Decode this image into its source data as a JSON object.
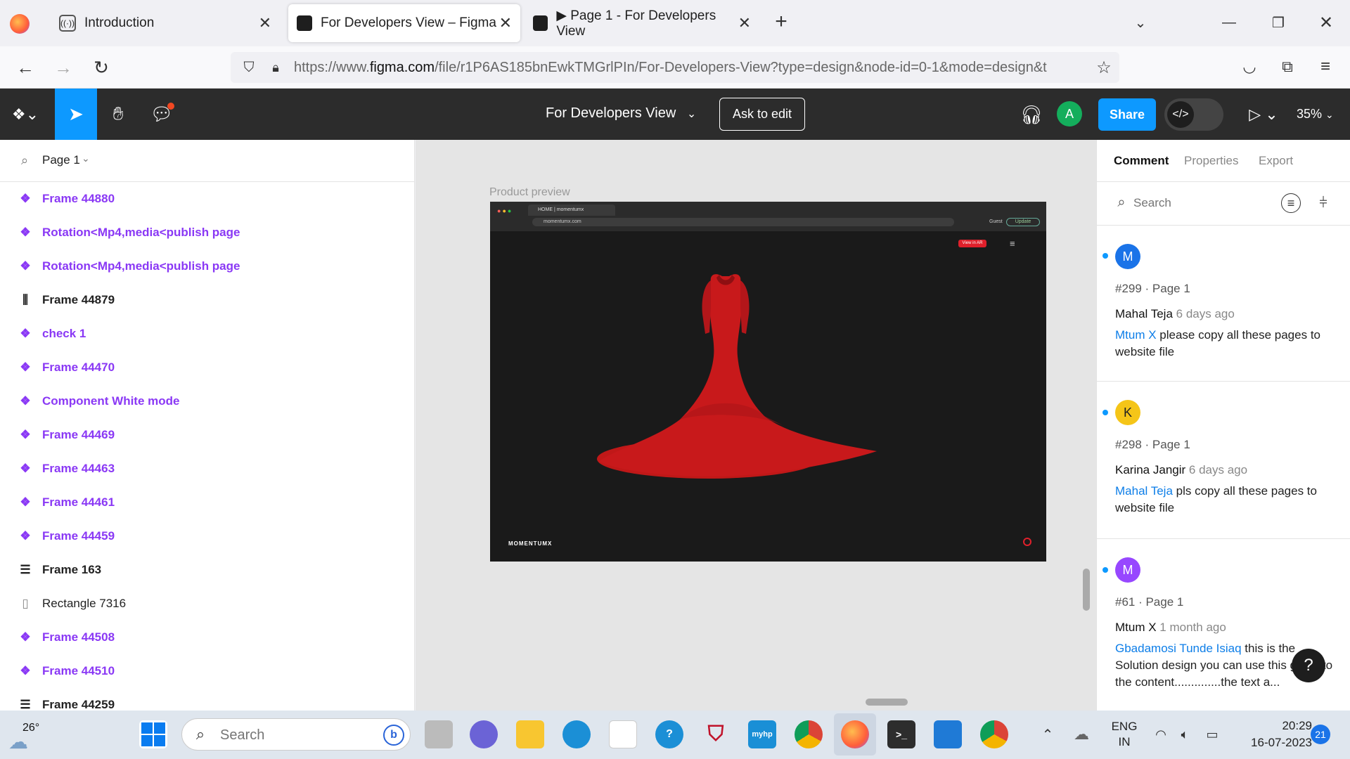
{
  "browser": {
    "tabs": [
      {
        "label": "Introduction"
      },
      {
        "label": "For Developers View – Figma"
      },
      {
        "label": "▶ Page 1 - For Developers View"
      }
    ],
    "url_prefix": "https://www.",
    "url_domain": "figma.com",
    "url_rest": "/file/r1P6AS185bnEwkTMGrlPIn/For-Developers-View?type=design&node-id=0-1&mode=design&t"
  },
  "figma": {
    "file_title": "For Developers View",
    "ask_to_edit": "Ask to edit",
    "avatar_initial": "A",
    "share_label": "Share",
    "zoom": "35%",
    "page_selector": "Page 1",
    "layers": [
      {
        "name": "Frame 44880",
        "icon": "component-icon",
        "style": "purple"
      },
      {
        "name": "Rotation<Mp4,media<publish page",
        "icon": "component-icon",
        "style": "purple"
      },
      {
        "name": "Rotation<Mp4,media<publish page",
        "icon": "component-icon",
        "style": "purple"
      },
      {
        "name": "Frame 44879",
        "icon": "auto-layout-horizontal-icon",
        "style": "dark"
      },
      {
        "name": "check 1",
        "icon": "component-icon",
        "style": "purple"
      },
      {
        "name": "Frame 44470",
        "icon": "component-icon",
        "style": "purple"
      },
      {
        "name": "Component White mode",
        "icon": "component-icon",
        "style": "purple"
      },
      {
        "name": "Frame 44469",
        "icon": "component-icon",
        "style": "purple"
      },
      {
        "name": "Frame 44463",
        "icon": "component-icon",
        "style": "purple"
      },
      {
        "name": "Frame 44461",
        "icon": "component-icon",
        "style": "purple"
      },
      {
        "name": "Frame 44459",
        "icon": "component-icon",
        "style": "purple"
      },
      {
        "name": "Frame 163",
        "icon": "auto-layout-vertical-icon",
        "style": "dark"
      },
      {
        "name": "Rectangle 7316",
        "icon": "rectangle-icon",
        "style": "plain"
      },
      {
        "name": "Frame 44508",
        "icon": "component-icon",
        "style": "purple"
      },
      {
        "name": "Frame 44510",
        "icon": "component-icon",
        "style": "purple"
      },
      {
        "name": "Frame 44259",
        "icon": "auto-layout-vertical-icon",
        "style": "dark"
      }
    ],
    "canvas": {
      "frame_label": "Product preview",
      "preview_tab": "HOME | momentumx",
      "preview_url": "momentumx.com",
      "preview_guest": "Guest",
      "preview_update": "Update",
      "preview_view_ar": "View in AR",
      "preview_logo": "MOMENTUMX"
    },
    "right_tabs": [
      "Comment",
      "Properties",
      "Export"
    ],
    "search_placeholder": "Search",
    "comments": [
      {
        "initial": "M",
        "color": "#1a73e8",
        "meta": "#299 · Page 1",
        "author": "Mahal Teja",
        "time": "6 days ago",
        "mention": "Mtum X",
        "text": " please copy all these pages to website file"
      },
      {
        "initial": "K",
        "color": "#f5c518",
        "meta": "#298 · Page 1",
        "author": "Karina Jangir",
        "time": "6 days ago",
        "mention": "Mahal Teja",
        "text": " pls copy all these pages to website file"
      },
      {
        "initial": "M",
        "color": "#9747ff",
        "meta": "#61 · Page 1",
        "author": "Mtum X",
        "time": "1 month ago",
        "mention": "Gbadamosi Tunde Isiaq",
        "text": " this is the Solution design you can use this guide to the content..............the text a..."
      }
    ]
  },
  "taskbar": {
    "weather_temp": "26°",
    "search_placeholder": "Search",
    "lang": "ENG",
    "region": "IN",
    "time": "20:29",
    "date": "16-07-2023",
    "notifications": "21"
  }
}
